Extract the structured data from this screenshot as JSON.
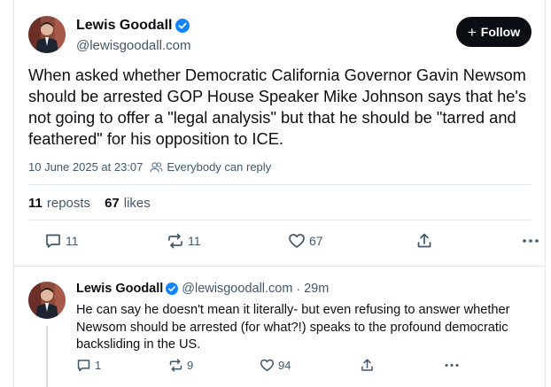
{
  "post": {
    "author": {
      "name": "Lewis Goodall",
      "handle": "@lewisgoodall.com",
      "verified": true
    },
    "follow_label": "Follow",
    "text": "When asked whether Democratic California Governor Gavin Newsom should be arrested GOP House Speaker Mike Johnson says that he's not going to offer a \"legal analysis\" but that he should be \"tarred and feathered\" for his opposition to ICE.",
    "timestamp": "10 June 2025 at 23:07",
    "reply_permission": "Everybody can reply",
    "stats": {
      "reposts_count": "11",
      "reposts_label": "reposts",
      "likes_count": "67",
      "likes_label": "likes"
    },
    "actions": {
      "replies": "11",
      "reposts": "11",
      "likes": "67"
    }
  },
  "reply": {
    "author": {
      "name": "Lewis Goodall",
      "handle": "@lewisgoodall.com",
      "verified": true
    },
    "separator": "·",
    "time": "29m",
    "text": "He can say he doesn't mean it literally- but even refusing to answer whether Newsom should be arrested (for what?!)  speaks to the profound democratic backsliding in the US.",
    "actions": {
      "replies": "1",
      "reposts": "9",
      "likes": "94"
    }
  },
  "icons": [
    "avatar",
    "verified-badge-icon",
    "plus-icon",
    "people-icon",
    "reply-icon",
    "repost-icon",
    "like-icon",
    "share-icon",
    "more-icon"
  ],
  "colors": {
    "text": "#0b0f14",
    "muted": "#42576b",
    "verified": "#1185fe",
    "follow_bg": "#0b0f14",
    "border": "#e3e8ee"
  }
}
